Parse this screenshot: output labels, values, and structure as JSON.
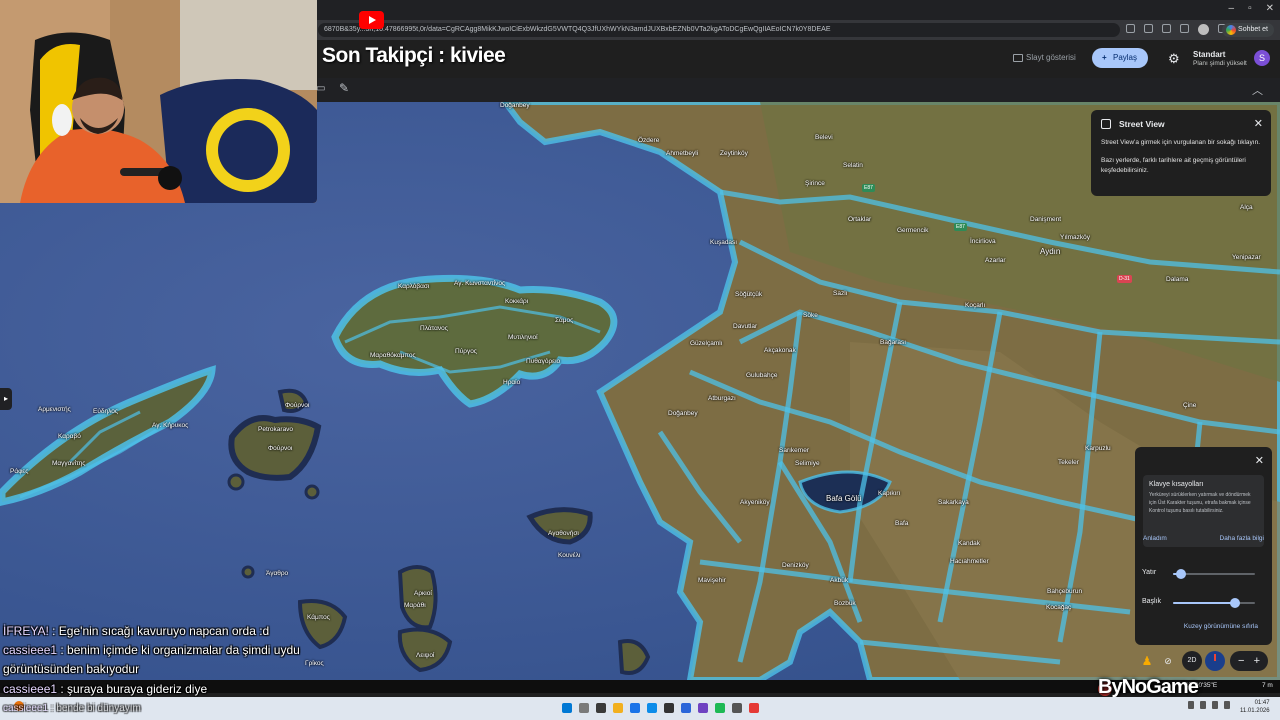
{
  "browser": {
    "url": "6870B&35y...3h,10.47866995t,0r/data=CgRCAgg8MikKJwoICiExbWkzdG5VWTQ4Q3JfUXhWYkN3amdJUXBxbEZNb0VTa2kgAToDCgEwQgIIAEoICN7k0Y8DEAE",
    "chat_button": "Sohbet et",
    "window_controls": [
      "–",
      "▫",
      "✕"
    ]
  },
  "stream": {
    "title": "Son Takipçi : kiviee",
    "watermark": "ByNoGame"
  },
  "earth_header": {
    "slideshow_label": "Slayt gösterisi",
    "share_label": "Paylaş",
    "plan_name": "Standart",
    "plan_upgrade": "Planı şimdi yükselt",
    "avatar_letter": "S"
  },
  "street_view_panel": {
    "title": "Street View",
    "line1": "Street View'a girmek için vurgulanan bir sokağı tıklayın.",
    "line2": "Bazı yerlerde, farklı tarihlere ait geçmiş görüntüleri keşfedebilirsiniz."
  },
  "keyboard_panel": {
    "title": "Klavye kısayolları",
    "text": "Yerküreyi sürüklerken yatırmak ve döndürmek için Üst Karakter tuşunu, etrafa bakmak içinse Kontrol tuşunu basılı tutabilirsiniz.",
    "ok_link": "Anladım",
    "more_link": "Daha fazla bilgi",
    "tilt_label": "Yatır",
    "heading_label": "Başlık",
    "tilt_value": 0.1,
    "heading_value": 0.75,
    "reset_link": "Kuzey görünümüne sıfırla"
  },
  "map_controls": {
    "btn_2d": "2D",
    "zoom_minus": "−",
    "zoom_plus": "+",
    "coords": "27°00'35\"E",
    "scale": "7 m"
  },
  "map_labels": [
    {
      "text": "Doğanbey",
      "kind": "small"
    },
    {
      "text": "Özdere",
      "kind": "small"
    },
    {
      "text": "Ahmetbeyli",
      "kind": "small"
    },
    {
      "text": "Zeytinköy",
      "kind": "small"
    },
    {
      "text": "Belevi",
      "kind": "small"
    },
    {
      "text": "Selatin",
      "kind": "small"
    },
    {
      "text": "Şirince",
      "kind": "small"
    },
    {
      "text": "Ortaklar",
      "kind": "small"
    },
    {
      "text": "Germencik",
      "kind": "small"
    },
    {
      "text": "İncirliova",
      "kind": "small"
    },
    {
      "text": "Yılmazköy",
      "kind": "small"
    },
    {
      "text": "Aydın",
      "kind": "big"
    },
    {
      "text": "Kuşadası",
      "kind": "small"
    },
    {
      "text": "Söğütçük",
      "kind": "small"
    },
    {
      "text": "Söke",
      "kind": "small"
    },
    {
      "text": "Sazlı",
      "kind": "small"
    },
    {
      "text": "Koçarlı",
      "kind": "small"
    },
    {
      "text": "Dalama",
      "kind": "small"
    },
    {
      "text": "Yenipazar",
      "kind": "small"
    },
    {
      "text": "Davutlar",
      "kind": "small"
    },
    {
      "text": "Güzelçamlı",
      "kind": "small"
    },
    {
      "text": "Akçakonak",
      "kind": "small"
    },
    {
      "text": "Bağarası",
      "kind": "small"
    },
    {
      "text": "Gulubahçe",
      "kind": "small"
    },
    {
      "text": "Atburgazı",
      "kind": "small"
    },
    {
      "text": "Doğanbey",
      "kind": "small"
    },
    {
      "text": "Sarıkemer",
      "kind": "small"
    },
    {
      "text": "Selimiye",
      "kind": "small"
    },
    {
      "text": "Akyeniköy",
      "kind": "small"
    },
    {
      "text": "Bafa Gölü",
      "kind": "big"
    },
    {
      "text": "Kapıkırı",
      "kind": "small"
    },
    {
      "text": "Bafa",
      "kind": "small"
    },
    {
      "text": "Denizköy",
      "kind": "small"
    },
    {
      "text": "Akbük",
      "kind": "small"
    },
    {
      "text": "Mavişehir",
      "kind": "small"
    },
    {
      "text": "Bozbük",
      "kind": "small"
    },
    {
      "text": "Kandak",
      "kind": "small"
    },
    {
      "text": "Sakarkaya",
      "kind": "small"
    },
    {
      "text": "Hacıahmetler",
      "kind": "small"
    },
    {
      "text": "Bahçeburun",
      "kind": "small"
    },
    {
      "text": "Kocağaç",
      "kind": "small"
    },
    {
      "text": "Tekeler",
      "kind": "small"
    },
    {
      "text": "Karpuzlu",
      "kind": "small"
    },
    {
      "text": "Çine",
      "kind": "small"
    },
    {
      "text": "Danişment",
      "kind": "small"
    },
    {
      "text": "Alça",
      "kind": "small"
    },
    {
      "text": "Azarlar",
      "kind": "small"
    },
    {
      "text": "Καρλόβασι",
      "kind": "small"
    },
    {
      "text": "Αγ. Κωνσταντίνος",
      "kind": "small"
    },
    {
      "text": "Κοκκάρι",
      "kind": "small"
    },
    {
      "text": "Σάμος",
      "kind": "small"
    },
    {
      "text": "Πλάτανος",
      "kind": "small"
    },
    {
      "text": "Πύργος",
      "kind": "small"
    },
    {
      "text": "Μυτιληνιοί",
      "kind": "small"
    },
    {
      "text": "Πυθαγόρειο",
      "kind": "small"
    },
    {
      "text": "Ηραίο",
      "kind": "small"
    },
    {
      "text": "Μαραθόκαμπος",
      "kind": "small"
    },
    {
      "text": "Ράφες",
      "kind": "small"
    },
    {
      "text": "Αρμενιστής",
      "kind": "small"
    },
    {
      "text": "Εύδηλος",
      "kind": "small"
    },
    {
      "text": "Αγ. Κήρυκος",
      "kind": "small"
    },
    {
      "text": "Καραβό",
      "kind": "small"
    },
    {
      "text": "Μαγγανίτης",
      "kind": "small"
    },
    {
      "text": "Φούρνοι",
      "kind": "small"
    },
    {
      "text": "Petrokaravo",
      "kind": "small"
    },
    {
      "text": "Φούρνοι",
      "kind": "small"
    },
    {
      "text": "Αγαθονήσι",
      "kind": "small"
    },
    {
      "text": "Κουνέλι",
      "kind": "small"
    },
    {
      "text": "Άγαθρο",
      "kind": "small"
    },
    {
      "text": "Αρκιοί",
      "kind": "small"
    },
    {
      "text": "Μαράθι",
      "kind": "small"
    },
    {
      "text": "Λειψοί",
      "kind": "small"
    },
    {
      "text": "Κάμπος",
      "kind": "small"
    },
    {
      "text": "Γρίκος",
      "kind": "small"
    }
  ],
  "road_badges": [
    {
      "text": "E87",
      "color": "#2e8b57"
    },
    {
      "text": "E87",
      "color": "#2e8b57"
    },
    {
      "text": "D-31",
      "color": "#d94452"
    }
  ],
  "chat": [
    {
      "user": "İFREYA!",
      "msg": " : Ege'nin sıcağı kavuruyo napcan orda :d",
      "faded": false
    },
    {
      "user": "cassieee1",
      "msg": " : benim içimde ki organizmalar da şimdi uydu",
      "faded": false
    },
    {
      "user": "",
      "msg": "görüntüsünden bakıyodur",
      "faded": false
    },
    {
      "user": "cassieee1",
      "msg": " : şuraya buraya gideriz diye",
      "faded": false
    },
    {
      "user": "cassieee1",
      "msg": " : bende bi dünyayım",
      "faded": true
    }
  ],
  "taskbar": {
    "clock_time": "01:47",
    "clock_date": "11.01.2026"
  },
  "colors": {
    "sea": "#3a5591",
    "land": "#7a6a43",
    "streetview_overlay": "#4ec1e8",
    "accent": "#a8c7fa"
  }
}
